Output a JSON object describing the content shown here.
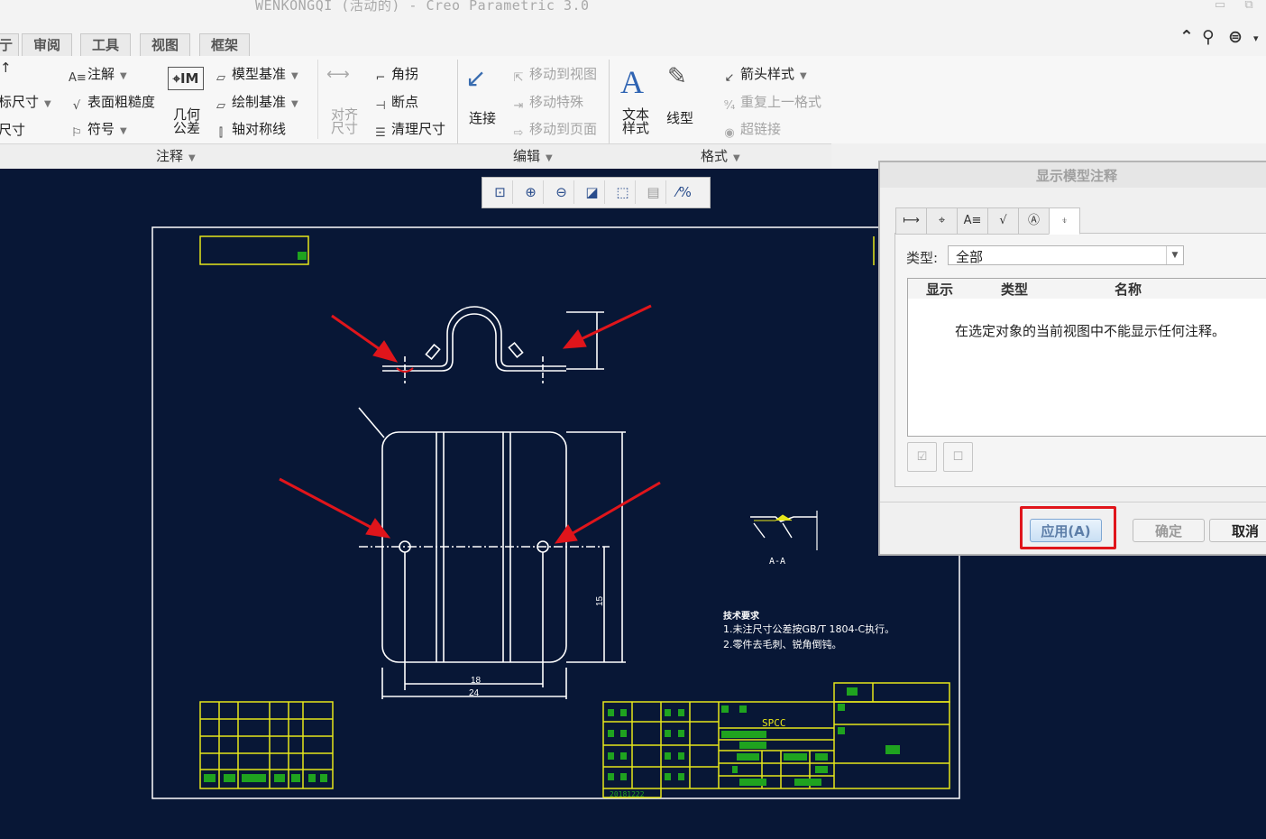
{
  "window": {
    "title": "WENKONGQI (活动的) - Creo Parametric 3.0"
  },
  "tabs": [
    "审阅",
    "工具",
    "视图",
    "框架"
  ],
  "ribbon": {
    "annotate_left": [
      "标尺寸",
      "尺寸"
    ],
    "annotate": {
      "note": "注解",
      "surface_finish": "表面粗糙度",
      "symbol": "符号",
      "geometric_tolerance": "几何公差",
      "model_datum": "模型基准",
      "sketch_datum": "绘制基准",
      "axis_symmetry": "轴对称线",
      "corner": "角拐",
      "breakpoint": "断点",
      "align_dimension": "对齐尺寸",
      "cleanup_dimension": "清理尺寸"
    },
    "edit": {
      "connect": "连接",
      "move_to_view": "移动到视图",
      "move_special": "移动特殊",
      "move_to_page": "移动到页面"
    },
    "format": {
      "text_style": "文本样式",
      "line_style": "线型",
      "arrow_style": "箭头样式",
      "repeat_last_format": "重复上一格式",
      "hyperlink": "超链接"
    },
    "groups": [
      "注释",
      "编辑",
      "格式"
    ]
  },
  "drawing": {
    "section_label": "A-A",
    "notes_title": "技术要求",
    "notes": [
      "1.未注尺寸公差按GB/T 1804-C执行。",
      "2.零件去毛刺、锐角倒钝。"
    ],
    "material": "SPCC",
    "date": "20181222",
    "dims": {
      "width_18": "18",
      "width_24": "24",
      "height_15": "15"
    }
  },
  "dialog": {
    "title": "显示模型注释",
    "type_label": "类型:",
    "type_value": "全部",
    "columns": [
      "显示",
      "类型",
      "名称"
    ],
    "empty_message": "在选定对象的当前视图中不能显示任何注释。",
    "apply_label": "应用(A)",
    "ok_label": "确定",
    "cancel_label": "取消"
  },
  "colors": {
    "canvas_bg": "#081736",
    "drawing_line": "#ffffff",
    "title_block": "#e6e61a",
    "arrow": "#e0151b"
  }
}
